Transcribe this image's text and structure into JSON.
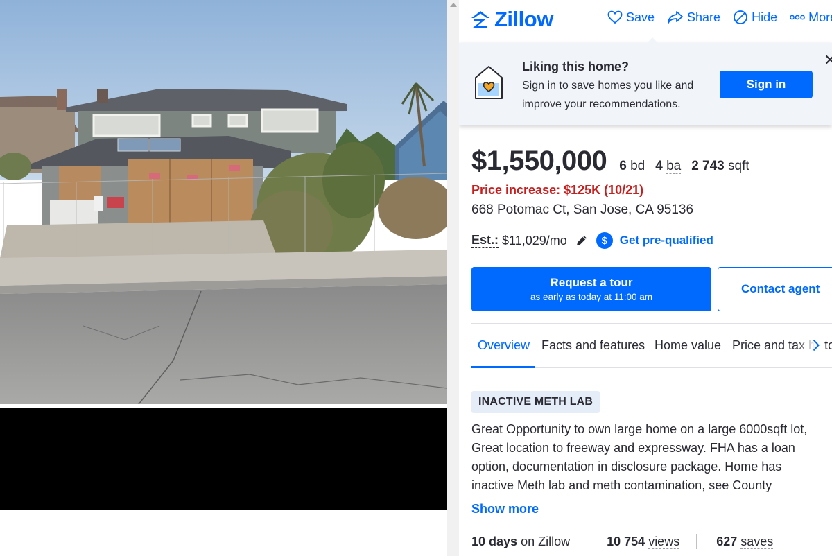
{
  "brand": {
    "logo_text": "Zillow",
    "color": "#006aff"
  },
  "header": {
    "actions": [
      {
        "label": "Save",
        "icon": "heart-icon"
      },
      {
        "label": "Share",
        "icon": "share-icon"
      },
      {
        "label": "Hide",
        "icon": "hide-icon"
      },
      {
        "label": "More",
        "icon": "more-icon"
      }
    ]
  },
  "promo": {
    "title": "Liking this home?",
    "body": "Sign in to save homes you like and improve your recommendations.",
    "button": "Sign in",
    "close": "✕"
  },
  "listing": {
    "price": "$1,550,000",
    "beds_value": "6",
    "beds_unit": "bd",
    "baths_value": "4",
    "baths_unit": "ba",
    "sqft_value": "2 743",
    "sqft_unit": "sqft",
    "price_change": "Price increase: $125K (10/21)",
    "address": "668 Potomac Ct, San Jose, CA 95136",
    "est_label": "Est.:",
    "est_value": "$11,029/mo",
    "prequal_link": "Get pre-qualified",
    "price_change_color": "#c81e1e"
  },
  "cta": {
    "tour_label": "Request a tour",
    "tour_sub": "as early as today at 11:00 am",
    "contact_label": "Contact agent"
  },
  "tabs": [
    {
      "label": "Overview",
      "active": true
    },
    {
      "label": "Facts and features",
      "active": false
    },
    {
      "label": "Home value",
      "active": false
    },
    {
      "label": "Price and tax history",
      "active": false
    }
  ],
  "overview": {
    "badge": "INACTIVE METH LAB",
    "description": "Great Opportunity to own large home on a large 6000sqft lot, Great location to freeway and expressway. FHA has a loan option, documentation in disclosure package. Home has inactive Meth lab and meth contamination, see County",
    "show_more": "Show more"
  },
  "stats": {
    "days_value": "10 days",
    "days_label": "on Zillow",
    "views_value": "10 754",
    "views_label": "views",
    "saves_value": "627",
    "saves_label": "saves"
  }
}
